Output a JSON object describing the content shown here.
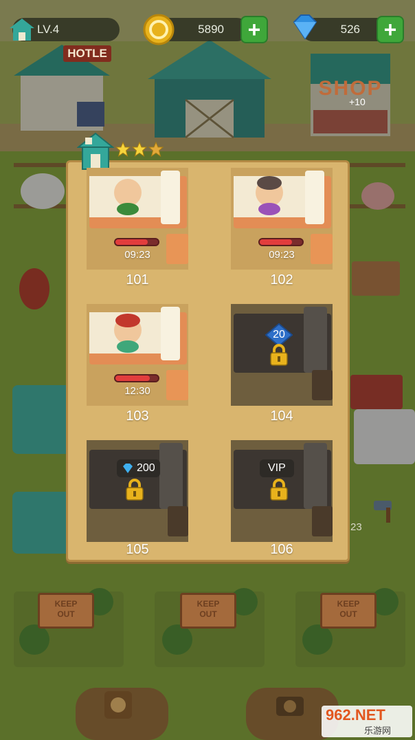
{
  "hud": {
    "level": "LV.4",
    "coins": "5890",
    "gems": "526"
  },
  "buildings": {
    "hotel_sign": "HOTLE",
    "shop_sign": "SHOP",
    "shop_badge": "+10"
  },
  "rating": {
    "stars": 3
  },
  "rooms": [
    {
      "number": "101",
      "state": "occupied",
      "timer": "09:23",
      "progress": 0.75
    },
    {
      "number": "102",
      "state": "occupied",
      "timer": "09:23",
      "progress": 0.75
    },
    {
      "number": "103",
      "state": "occupied",
      "timer": "12:30",
      "progress": 0.8
    },
    {
      "number": "104",
      "state": "locked",
      "unlock_level": "20"
    },
    {
      "number": "105",
      "state": "locked",
      "unlock_price": "200"
    },
    {
      "number": "106",
      "state": "locked",
      "unlock_tag": "VIP"
    }
  ],
  "keep_out_signs": [
    "KEEP\nOUT",
    "KEEP\nOUT",
    "KEEP\nOUT"
  ],
  "side_timer": "23",
  "watermark": {
    "brand": "962.NET",
    "sub": "乐游网"
  },
  "colors": {
    "accent_green": "#3fa73a",
    "timer_red": "#e23d3d",
    "panel": "#d9b56e",
    "gem_blue": "#2e8fe0"
  }
}
